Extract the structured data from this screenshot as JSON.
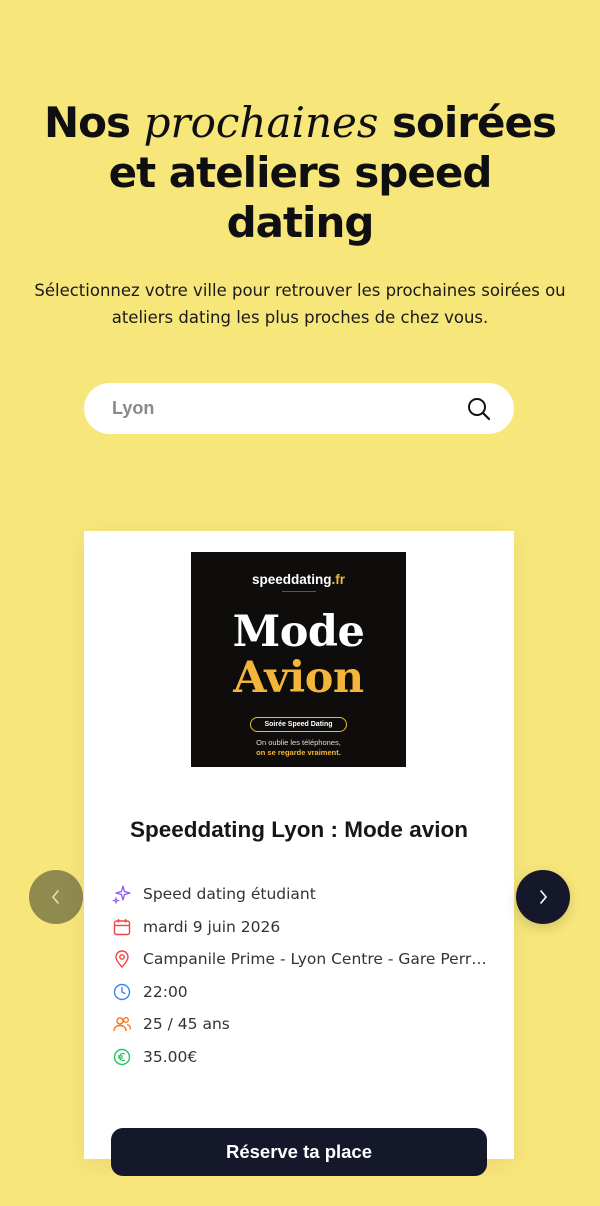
{
  "hero": {
    "title_part1": "Nos",
    "title_italic": "prochaines",
    "title_part2": "soirées",
    "title_line2": "et ateliers speed",
    "title_line3": "dating",
    "subtitle": "Sélectionnez votre ville pour retrouver les prochaines soirées ou ateliers dating les plus proches de chez vous."
  },
  "search": {
    "placeholder": "Lyon",
    "icon": "search-icon"
  },
  "event": {
    "poster": {
      "brand_main": "speeddating",
      "brand_tld": ".fr",
      "title_line1": "Mode",
      "title_line2": "Avion",
      "pill": "Soirée Speed Dating",
      "tagline1": "On oublie les téléphones,",
      "tagline2_part1": "on se ",
      "tagline2_part2": "regarde vraiment."
    },
    "title": "Speeddating Lyon : Mode avion",
    "category": "Speed dating étudiant",
    "date": "mardi 9 juin 2026",
    "location": "Campanile Prime - Lyon Centre - Gare Perrac...",
    "time": "22:00",
    "age": "25 / 45 ans",
    "price": "35.00€",
    "cta": "Réserve ta place"
  },
  "colors": {
    "background": "#f7e67a",
    "button_dark": "#15182a",
    "accent_gold": "#f4b63a",
    "icon_purple": "#8b5cf6",
    "icon_red": "#ef4444",
    "icon_blue": "#3b82f6",
    "icon_orange": "#f97316",
    "icon_green": "#22c55e"
  }
}
